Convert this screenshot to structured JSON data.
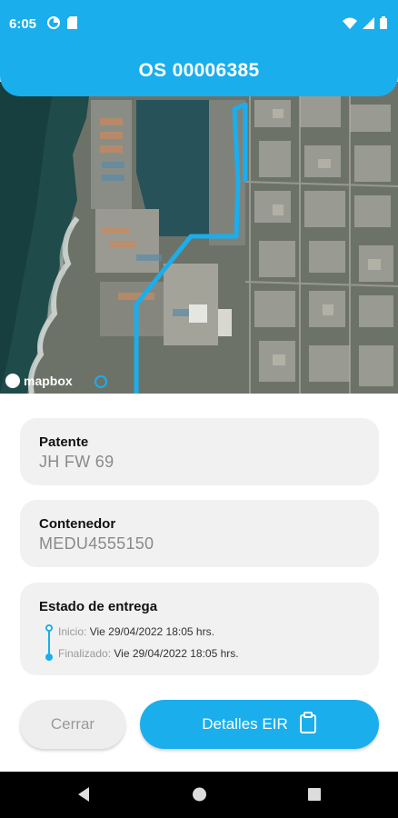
{
  "status_bar": {
    "time": "6:05",
    "left_icons": [
      "data-saver-icon",
      "sd-card-icon"
    ],
    "right_icons": [
      "wifi-icon",
      "cell-signal-icon",
      "battery-icon"
    ]
  },
  "header": {
    "title": "OS 00006385"
  },
  "map": {
    "attribution": "mapbox",
    "route_color": "#1aaeed"
  },
  "cards": {
    "patente": {
      "label": "Patente",
      "value": "JH FW 69"
    },
    "contenedor": {
      "label": "Contenedor",
      "value": "MEDU4555150"
    },
    "estado": {
      "label": "Estado de entrega",
      "inicio_label": "Inicio:",
      "inicio_value": "Vie 29/04/2022 18:05 hrs.",
      "finalizado_label": "Finalizado:",
      "finalizado_value": "Vie 29/04/2022 18:05 hrs."
    }
  },
  "buttons": {
    "close_label": "Cerrar",
    "eir_label": "Detalles EIR",
    "eir_icon": "clipboard-icon"
  },
  "nav": [
    "back-icon",
    "home-icon",
    "recents-icon"
  ],
  "colors": {
    "accent": "#1aaeed",
    "card_bg": "#f1f1f1"
  }
}
